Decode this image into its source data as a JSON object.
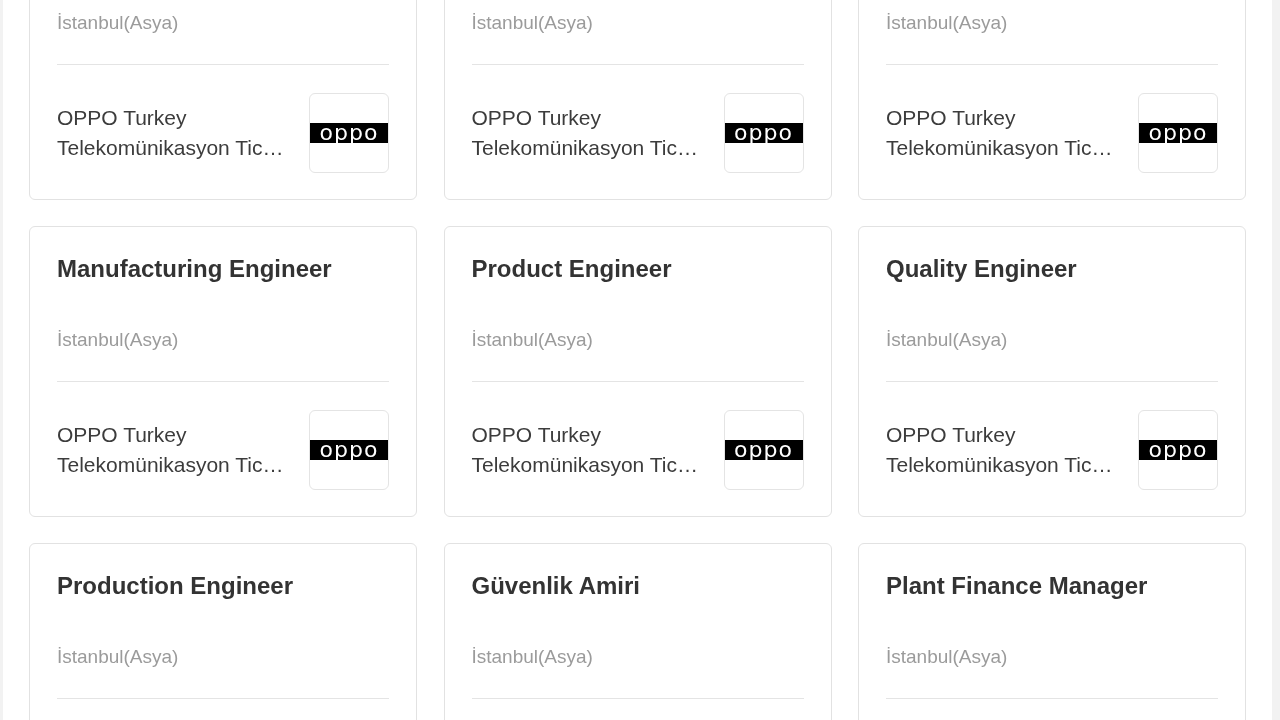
{
  "job_cards": [
    {
      "location": "İstanbul(Asya)",
      "company": "OPPO Turkey Telekomünikasyon Tic…",
      "logo_text": "oppo"
    },
    {
      "location": "İstanbul(Asya)",
      "company": "OPPO Turkey Telekomünikasyon Tic…",
      "logo_text": "oppo"
    },
    {
      "location": "İstanbul(Asya)",
      "company": "OPPO Turkey Telekomünikasyon Tic…",
      "logo_text": "oppo"
    },
    {
      "title": "Manufacturing Engineer",
      "location": "İstanbul(Asya)",
      "company": "OPPO Turkey Telekomünikasyon Tic…",
      "logo_text": "oppo"
    },
    {
      "title": "Product Engineer",
      "location": "İstanbul(Asya)",
      "company": "OPPO Turkey Telekomünikasyon Tic…",
      "logo_text": "oppo"
    },
    {
      "title": "Quality Engineer",
      "location": "İstanbul(Asya)",
      "company": "OPPO Turkey Telekomünikasyon Tic…",
      "logo_text": "oppo"
    },
    {
      "title": "Production Engineer",
      "location": "İstanbul(Asya)"
    },
    {
      "title": "Güvenlik Amiri",
      "location": "İstanbul(Asya)"
    },
    {
      "title": "Plant Finance Manager",
      "location": "İstanbul(Asya)"
    }
  ]
}
